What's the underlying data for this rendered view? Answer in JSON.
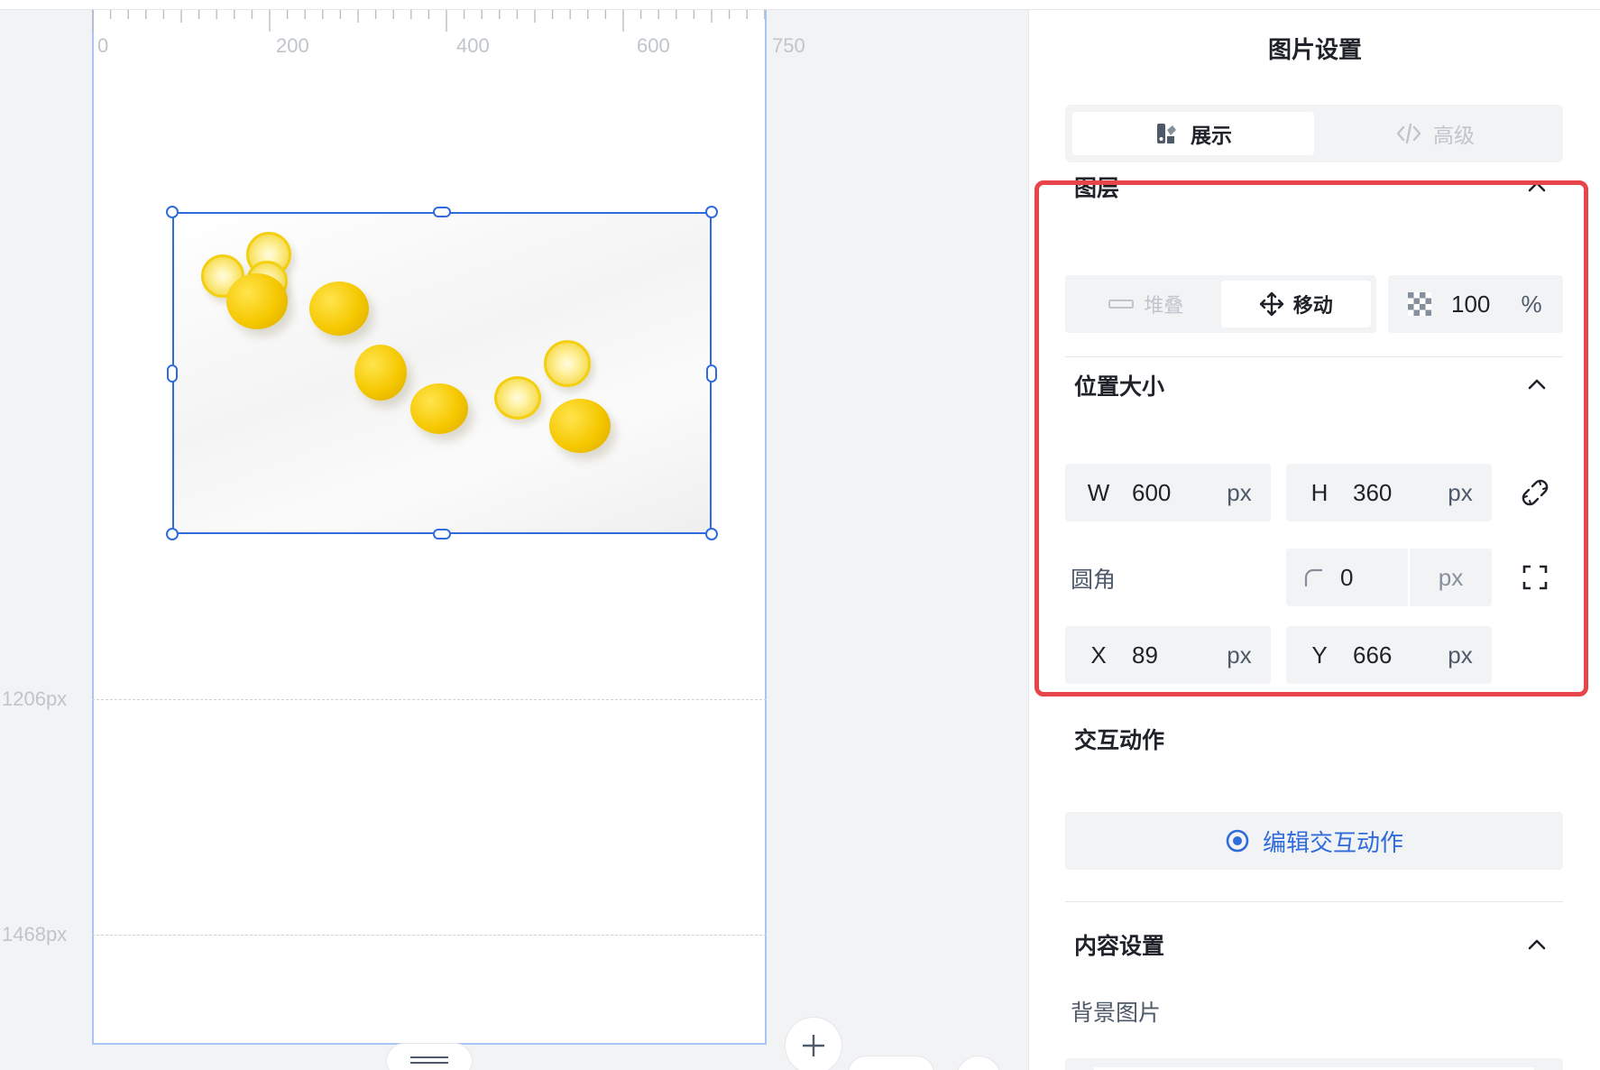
{
  "canvas": {
    "ruler_ticks": [
      "0",
      "200",
      "400",
      "600",
      "750"
    ],
    "guides": [
      "1206px",
      "1468px"
    ]
  },
  "panel": {
    "title": "图片设置",
    "tabs": [
      {
        "label": "展示",
        "icon": "palette-icon",
        "active": true
      },
      {
        "label": "高级",
        "icon": "code-icon",
        "active": false
      }
    ],
    "layer": {
      "title": "图层",
      "modes": [
        {
          "label": "堆叠",
          "icon": "stack-icon",
          "active": false
        },
        {
          "label": "移动",
          "icon": "move-icon",
          "active": true
        }
      ],
      "opacity": {
        "value": "100",
        "unit": "%"
      }
    },
    "position": {
      "title": "位置大小",
      "width": {
        "label": "W",
        "value": "600",
        "unit": "px"
      },
      "height": {
        "label": "H",
        "value": "360",
        "unit": "px"
      },
      "radius_label": "圆角",
      "radius": {
        "value": "0",
        "unit": "px"
      },
      "x": {
        "label": "X",
        "value": "89",
        "unit": "px"
      },
      "y": {
        "label": "Y",
        "value": "666",
        "unit": "px"
      }
    },
    "interaction": {
      "title": "交互动作",
      "button": "编辑交互动作"
    },
    "content": {
      "title": "内容设置",
      "bg_image_label": "背景图片"
    }
  },
  "colors": {
    "accent": "#2f6bdd",
    "highlight": "#e8454a",
    "field_bg": "#f2f3f5"
  }
}
